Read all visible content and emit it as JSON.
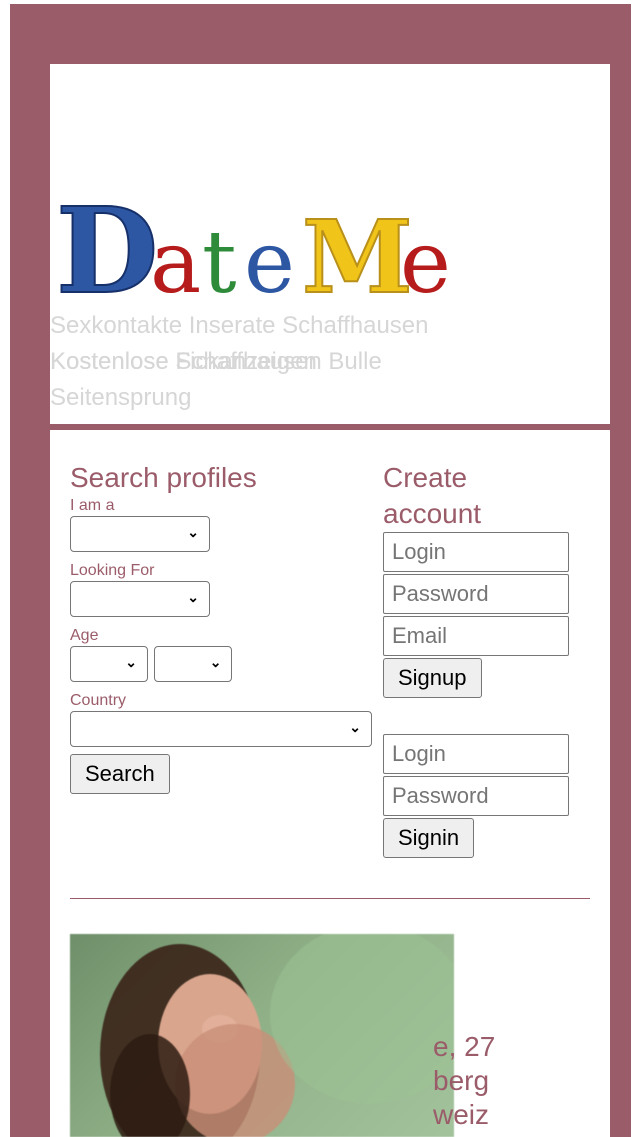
{
  "logo": {
    "text": "DateMe",
    "letters": [
      "D",
      "a",
      "t",
      "e",
      "M",
      "e"
    ]
  },
  "tagline": {
    "line1": "Sexkontakte Inserate Schaffhausen",
    "line2": "Kostenlose Schaffhausen Bulle",
    "line2_overlap": "Kostenlose Fickanzeigen",
    "line3": "Seitensprung"
  },
  "search": {
    "title": "Search profiles",
    "i_am_label": "I am a",
    "looking_label": "Looking For",
    "age_label": "Age",
    "country_label": "Country",
    "button": "Search"
  },
  "create": {
    "title_line1": "Create",
    "title_line2": "account",
    "login_placeholder": "Login",
    "password_placeholder": "Password",
    "email_placeholder": "Email",
    "button": "Signup"
  },
  "signin": {
    "login_placeholder": "Login",
    "password_placeholder": "Password",
    "button": "Signin"
  },
  "profile": {
    "line1": "e, 27",
    "line2": "berg",
    "line3": "weiz"
  },
  "icons": {
    "chevron": "chevron-down-icon"
  },
  "colors": {
    "frame": "#9b5c6a",
    "accent": "#9b5c6a",
    "tagline": "#d6d6d6"
  }
}
